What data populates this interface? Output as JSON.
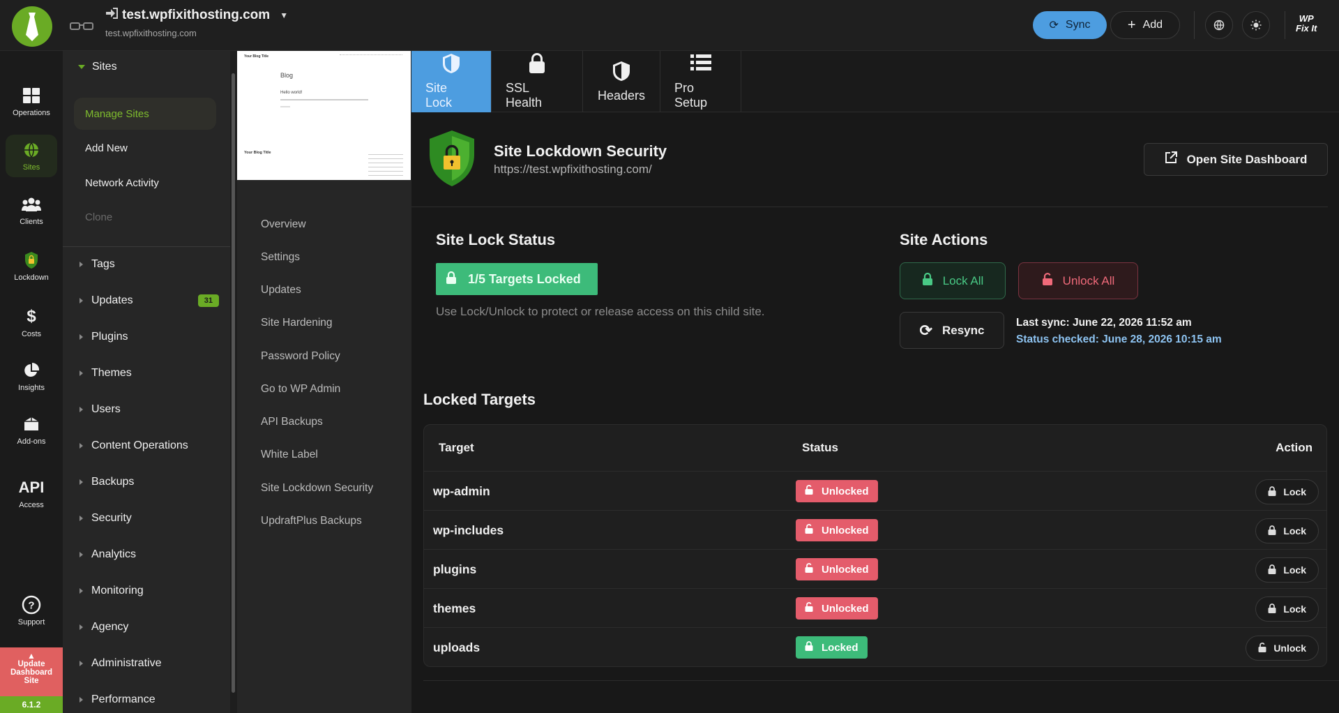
{
  "topbar": {
    "site_title": "test.wpfixithosting.com",
    "site_subtitle": "test.wpfixithosting.com",
    "sync_label": "Sync",
    "add_label": "Add",
    "brand_line1": "WP",
    "brand_line2": "Fix It"
  },
  "rail": {
    "operations": "Operations",
    "sites": "Sites",
    "clients": "Clients",
    "lockdown": "Lockdown",
    "costs": "Costs",
    "insights": "Insights",
    "addons": "Add-ons",
    "api_big": "API",
    "api": "Access",
    "support": "Support",
    "update_line1": "Update",
    "update_line2": "Dashboard",
    "update_line3": "Site",
    "version": "6.1.2"
  },
  "nav": {
    "heading": "Sites",
    "sub_items": [
      "Manage Sites",
      "Add New",
      "Network Activity",
      "Clone"
    ],
    "groups": [
      "Tags",
      "Updates",
      "Plugins",
      "Themes",
      "Users",
      "Content Operations",
      "Backups",
      "Security",
      "Analytics",
      "Monitoring",
      "Agency",
      "Administrative",
      "Performance"
    ],
    "updates_badge": "31"
  },
  "site_menu": {
    "thumb_header": "Your Blog Title",
    "thumb_heading": "Blog",
    "thumb_post": "Hello world!",
    "thumb_footer": "Your Blog Title",
    "items": [
      "Overview",
      "Settings",
      "Updates",
      "Site Hardening",
      "Password Policy",
      "Go to WP Admin",
      "API Backups",
      "White Label",
      "Site Lockdown Security",
      "UpdraftPlus Backups"
    ]
  },
  "tabs": [
    "Site Lock",
    "SSL Health",
    "Headers",
    "Pro Setup"
  ],
  "header": {
    "title": "Site Lockdown Security",
    "url": "https://test.wpfixithosting.com/",
    "open_dashboard": "Open Site Dashboard"
  },
  "status": {
    "title": "Site Lock Status",
    "pill": "1/5 Targets Locked",
    "help": "Use Lock/Unlock to protect or release access on this child site."
  },
  "actions": {
    "title": "Site Actions",
    "lock_all": "Lock All",
    "unlock_all": "Unlock All",
    "resync": "Resync",
    "last_sync": "Last sync: June 22, 2026 11:52 am",
    "status_checked": "Status checked: June 28, 2026 10:15 am"
  },
  "targets": {
    "title": "Locked Targets",
    "columns": [
      "Target",
      "Status",
      "Action"
    ],
    "rows": [
      {
        "name": "wp-admin",
        "status": "Unlocked",
        "action": "Lock"
      },
      {
        "name": "wp-includes",
        "status": "Unlocked",
        "action": "Lock"
      },
      {
        "name": "plugins",
        "status": "Unlocked",
        "action": "Lock"
      },
      {
        "name": "themes",
        "status": "Unlocked",
        "action": "Lock"
      },
      {
        "name": "uploads",
        "status": "Locked",
        "action": "Unlock"
      }
    ]
  },
  "colors": {
    "brand_green": "#6aab25",
    "accent_blue": "#4d9de0",
    "locked_green": "#3dbb7a",
    "unlocked_red": "#e45c6b"
  }
}
